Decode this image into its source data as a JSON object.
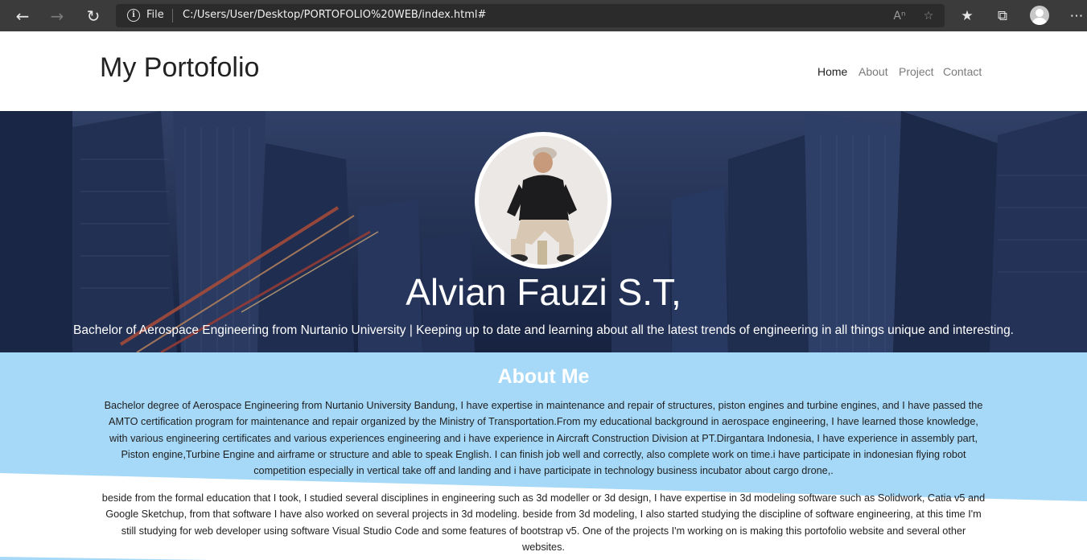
{
  "browser": {
    "file_label": "File",
    "url": "C:/Users/User/Desktop/PORTOFOLIO%20WEB/index.html#",
    "icons": [
      "back-arrow-icon",
      "forward-arrow-icon",
      "refresh-icon",
      "info-icon",
      "read-aloud-icon",
      "add-favorite-icon",
      "favorites-icon",
      "collections-icon",
      "profile-avatar-icon",
      "more-menu-icon"
    ]
  },
  "navbar": {
    "brand": "My Portofolio",
    "links": [
      {
        "label": "Home",
        "active": true
      },
      {
        "label": "About",
        "active": false
      },
      {
        "label": "Project",
        "active": false
      },
      {
        "label": "Contact",
        "active": false
      }
    ]
  },
  "hero": {
    "name": "Alvian Fauzi S.T,",
    "tagline": "Bachelor of Aerospace Engineering from Nurtanio University | Keeping up to date and learning about all the latest trends of engineering in all things unique and interesting."
  },
  "about": {
    "title": "About Me",
    "paragraphs": [
      "Bachelor degree of Aerospace Engineering from Nurtanio University Bandung, I have expertise in maintenance and repair of structures, piston engines and turbine engines, and I have passed the AMTO certification program for maintenance and repair organized by the Ministry of Transportation.From my educational background in aerospace engineering, I have learned those knowledge, with various engineering certificates and various experiences engineering and i have experience in Aircraft Construction Division at PT.Dirgantara Indonesia, I have experience in assembly part, Piston engine,Turbine Engine and airframe or structure and able to speak English. I can finish job well and correctly, also complete work on time.i have participate in indonesian flying robot competition especially in vertical take off and landing and i have participate in technology business incubator about cargo drone,.",
      "beside from the formal education that I took, I studied several disciplines in engineering such as 3d modeller or 3d design, I have expertise in 3d modeling software such as Solidwork, Catia v5 and Google Sketchup, from that software I have also worked on several projects in 3d modeling. beside from 3d modeling, I also started studying the discipline of software engineering, at this time I'm still studying for web developer using software Visual Studio Code and some features of bootstrap v5. One of the projects I'm working on is making this portofolio website and several other websites."
    ]
  },
  "colors": {
    "browser_bar": "#3b3b3b",
    "address_bar": "#2b2b2b",
    "hero_blue": "#25365a",
    "about_wave": "#a6d8f7",
    "brand_text": "#222222"
  }
}
